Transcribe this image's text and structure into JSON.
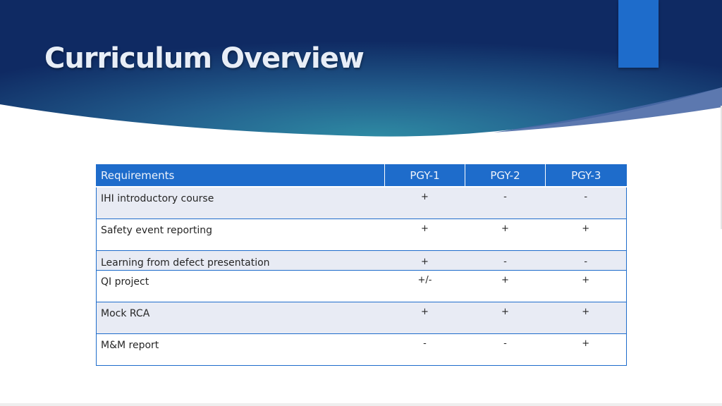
{
  "slide": {
    "title": "Curriculum Overview"
  },
  "colors": {
    "header_dark": "#0f2a63",
    "header_light": "#2e7d9a",
    "accent": "#1e6ccb",
    "row_shade": "#e8ebf4"
  },
  "table": {
    "headers": [
      "Requirements",
      "PGY-1",
      "PGY-2",
      "PGY-3"
    ],
    "rows": [
      {
        "requirement": "IHI introductory course",
        "pgy1": "+",
        "pgy2": "-",
        "pgy3": "-"
      },
      {
        "requirement": "Safety event reporting",
        "pgy1": "+",
        "pgy2": "+",
        "pgy3": "+"
      },
      {
        "requirement": "Learning from defect presentation",
        "pgy1": "+",
        "pgy2": "-",
        "pgy3": "-"
      },
      {
        "requirement": "QI project",
        "pgy1": "+/-",
        "pgy2": "+",
        "pgy3": "+"
      },
      {
        "requirement": "Mock RCA",
        "pgy1": "+",
        "pgy2": "+",
        "pgy3": "+"
      },
      {
        "requirement": "M&M report",
        "pgy1": "-",
        "pgy2": "-",
        "pgy3": "+"
      }
    ]
  }
}
